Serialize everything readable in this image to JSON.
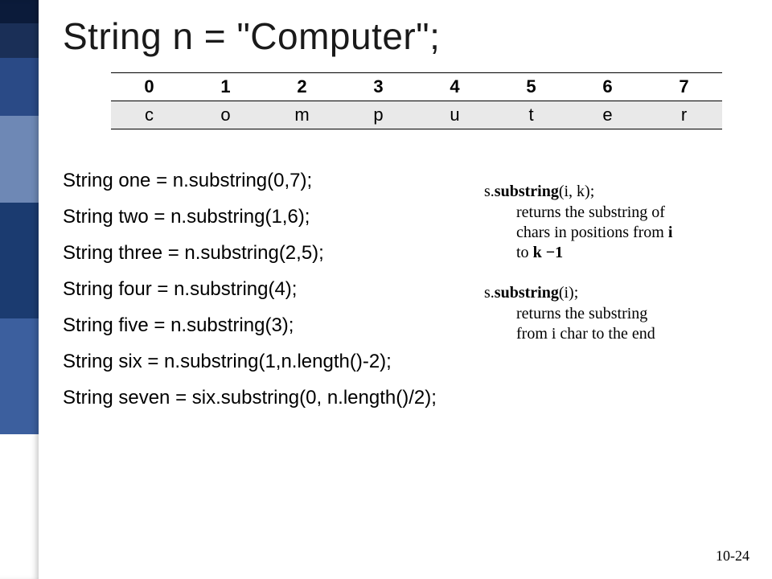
{
  "title": "String n = \"Computer\";",
  "index_table": {
    "indices": [
      "0",
      "1",
      "2",
      "3",
      "4",
      "5",
      "6",
      "7"
    ],
    "chars": [
      "c",
      "o",
      "m",
      "p",
      "u",
      "t",
      "e",
      "r"
    ]
  },
  "code_lines": [
    "String one = n.substring(0,7);",
    "String two = n.substring(1,6);",
    "String three = n.substring(2,5);",
    "String four = n.substring(4);",
    "String five = n.substring(3);",
    "String six = n.substring(1,n.length()-2);",
    "String seven = six.substring(0, n.length()/2);"
  ],
  "notes": {
    "n1_sig_s": "s.",
    "n1_sig_method": "substring",
    "n1_sig_args": "(i, k);",
    "n1_desc_a": "returns the substring of",
    "n1_desc_b": "chars in positions from ",
    "n1_kw_i": "i",
    "n1_desc_c": "to ",
    "n1_kw_k": "k",
    "n1_minus1": " −1",
    "n2_sig_s": "s.",
    "n2_sig_method": "substring",
    "n2_sig_args": "(i);",
    "n2_desc_a": "returns the substring",
    "n2_desc_b": "from i char to the end"
  },
  "page_number": "10-24"
}
